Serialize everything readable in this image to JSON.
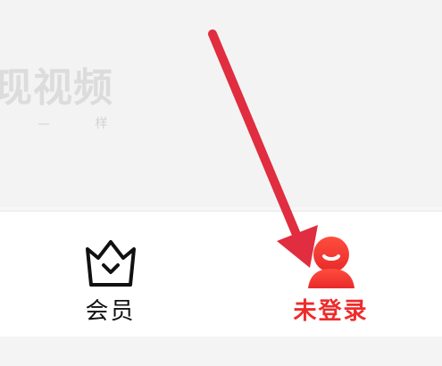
{
  "top": {
    "faded_title": "现视频",
    "faded_subtitle_char": "样"
  },
  "tabs": [
    {
      "label": "会员",
      "icon": "crown-icon",
      "color": "#111111"
    },
    {
      "label": "未登录",
      "icon": "avatar-icon",
      "color": "#ee2b2b"
    }
  ],
  "colors": {
    "accent_red": "#ee2b2b",
    "arrow_red": "#e02d3f",
    "tabbar_bg": "#ffffff",
    "page_bg": "#f6f6f6"
  }
}
